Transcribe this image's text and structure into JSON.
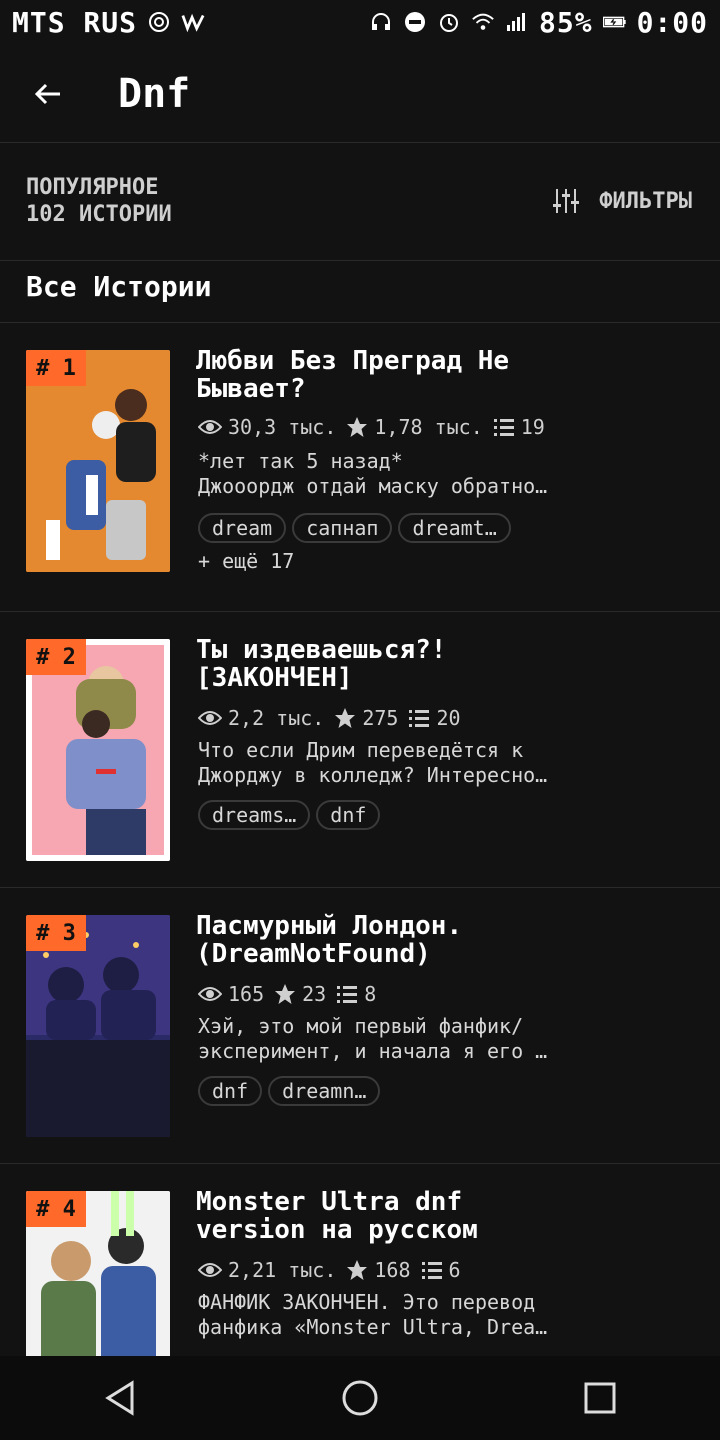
{
  "status_bar": {
    "carrier": "MTS RUS",
    "battery": "85%",
    "time": "0:00"
  },
  "header": {
    "title": "Dnf"
  },
  "meta": {
    "sort_label": "ПОПУЛЯРНОЕ",
    "stories_count": "102 ИСТОРИИ",
    "filters_label": "ФИЛЬТРЫ"
  },
  "section_title": "Все Истории",
  "stories": [
    {
      "rank": "# 1",
      "title_line1": "Любви Без Преград Не",
      "title_line2": "Бывает?",
      "views": "30,3 тыс.",
      "votes": "1,78 тыс.",
      "parts": "19",
      "desc_line1": "*лет так 5 назад*",
      "desc_line2": "Джооордж отдай маску обратно…",
      "tags": [
        "dream",
        "сапнап",
        "dreamt…"
      ],
      "more": "+ ещё 17",
      "cover_color": "#e4892f"
    },
    {
      "rank": "# 2",
      "title_line1": "Ты издеваешься?!",
      "title_line2": "[ЗАКОНЧЕН]",
      "views": "2,2 тыс.",
      "votes": "275",
      "parts": "20",
      "desc_line1": "Что если Дрим переведётся к",
      "desc_line2": "Джорджу в колледж? Интересно…",
      "tags": [
        "dreams…",
        "dnf"
      ],
      "more": "",
      "cover_color": "#f6a7b2"
    },
    {
      "rank": "# 3",
      "title_line1": "Пасмурный Лондон.",
      "title_line2": "(DreamNotFound)",
      "views": "165",
      "votes": "23",
      "parts": "8",
      "desc_line1": "Хэй, это мой первый фанфик/",
      "desc_line2": "эксперимент, и начала я его …",
      "tags": [
        "dnf",
        "dreamn…"
      ],
      "more": "",
      "cover_color": "#2a2a66"
    },
    {
      "rank": "# 4",
      "title_line1": "Monster Ultra dnf",
      "title_line2": "version на русском",
      "views": "2,21 тыс.",
      "votes": "168",
      "parts": "6",
      "desc_line1": "ФАНФИК ЗАКОНЧЕН. Это перевод",
      "desc_line2": "фанфика «Monster Ultra, Drea…",
      "tags": [],
      "more": "",
      "cover_color": "#f2f2f2"
    }
  ]
}
